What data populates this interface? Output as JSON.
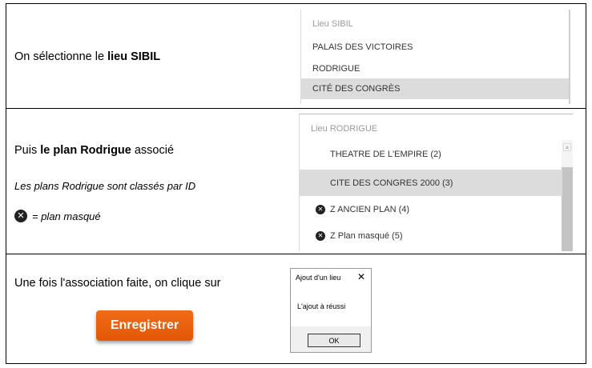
{
  "step1": {
    "text_prefix": "On sélectionne le ",
    "text_bold": "lieu SIBIL",
    "dropdown": {
      "header": "Lieu SIBIL",
      "items": [
        "PALAIS DES VICTOIRES",
        "RODRIGUE",
        "CITÉ DES CONGRÈS"
      ]
    }
  },
  "step2": {
    "text_prefix": "Puis ",
    "text_bold": "le plan Rodrigue",
    "text_suffix": " associé",
    "note": "Les plans Rodrigue sont classés par ID",
    "legend": "= plan masqué",
    "dropdown": {
      "header": "Lieu RODRIGUE",
      "items": [
        {
          "label": "THEATRE DE L'EMPIRE (2)",
          "hidden": false
        },
        {
          "label": "CITE DES CONGRES 2000 (3)",
          "hidden": false
        },
        {
          "label": "Z ANCIEN PLAN (4)",
          "hidden": true
        },
        {
          "label": "Z Plan masqué (5)",
          "hidden": true
        }
      ]
    }
  },
  "step3": {
    "text": "Une fois l'association faite, on clique sur",
    "button": "Enregistrer",
    "dialog": {
      "title": "Ajout d'un lieu",
      "close": "✕",
      "message": "L'ajout à réussi",
      "ok": "OK"
    }
  },
  "icons": {
    "hidden_plan": "x-circle-icon"
  },
  "colors": {
    "button": "#e8600c",
    "selected": "#dcdcdc"
  }
}
